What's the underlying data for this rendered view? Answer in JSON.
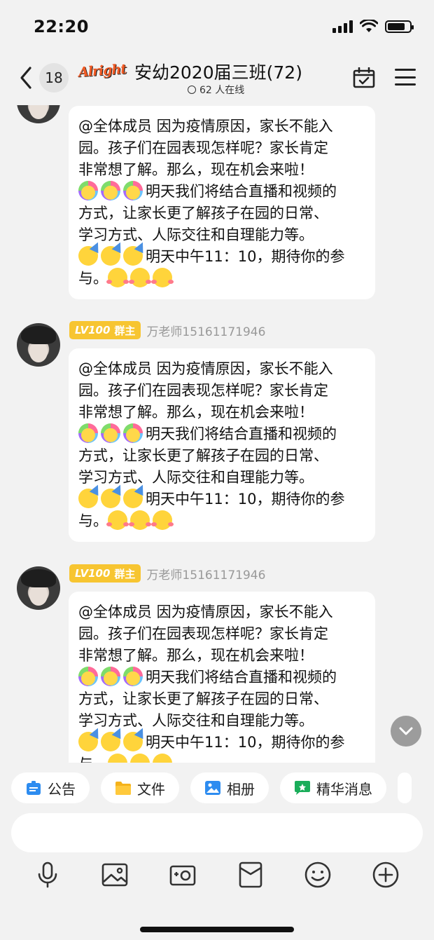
{
  "status_bar": {
    "time": "22:20"
  },
  "header": {
    "unread_count": "18",
    "logo_text": "Alright",
    "title": "安幼2020届三班(72)",
    "online_text": "62 人在线"
  },
  "messages": [
    {
      "lines": [
        "@全体成员 因为疫情原因，家长不能入",
        "园。孩子们在园表现怎样呢？家长肯定",
        "非常想了解。那么，现在机会来啦！",
        "明天我们将结合直播和视频的",
        "方式，让家长更了解孩子在园的日常、",
        "学习方式、人际交往和自理能力等。",
        "明天中午11：10，期待你的参",
        "与。"
      ]
    },
    {
      "level": "LV100",
      "role": "群主",
      "sender": "万老师15161171946",
      "lines": [
        "@全体成员 因为疫情原因，家长不能入",
        "园。孩子们在园表现怎样呢？家长肯定",
        "非常想了解。那么，现在机会来啦！",
        "明天我们将结合直播和视频的",
        "方式，让家长更了解孩子在园的日常、",
        "学习方式、人际交往和自理能力等。",
        "明天中午11：10，期待你的参",
        "与。"
      ]
    },
    {
      "level": "LV100",
      "role": "群主",
      "sender": "万老师15161171946",
      "lines": [
        "@全体成员 因为疫情原因，家长不能入",
        "园。孩子们在园表现怎样呢？家长肯定",
        "非常想了解。那么，现在机会来啦！",
        "明天我们将结合直播和视频的",
        "方式，让家长更了解孩子在园的日常、",
        "学习方式、人际交往和自理能力等。",
        "明天中午11：10，期待你的参",
        "与。"
      ]
    }
  ],
  "shortcuts": [
    {
      "label": "公告",
      "icon": "announcement-icon",
      "color": "#2d8cf0"
    },
    {
      "label": "文件",
      "icon": "folder-icon",
      "color": "#f5b21b"
    },
    {
      "label": "相册",
      "icon": "album-icon",
      "color": "#2d8cf0"
    },
    {
      "label": "精华消息",
      "icon": "highlights-icon",
      "color": "#1aad5a"
    }
  ],
  "toolbar": [
    "microphone-icon",
    "image-icon",
    "camera-icon",
    "red-packet-icon",
    "emoji-icon",
    "plus-icon"
  ]
}
